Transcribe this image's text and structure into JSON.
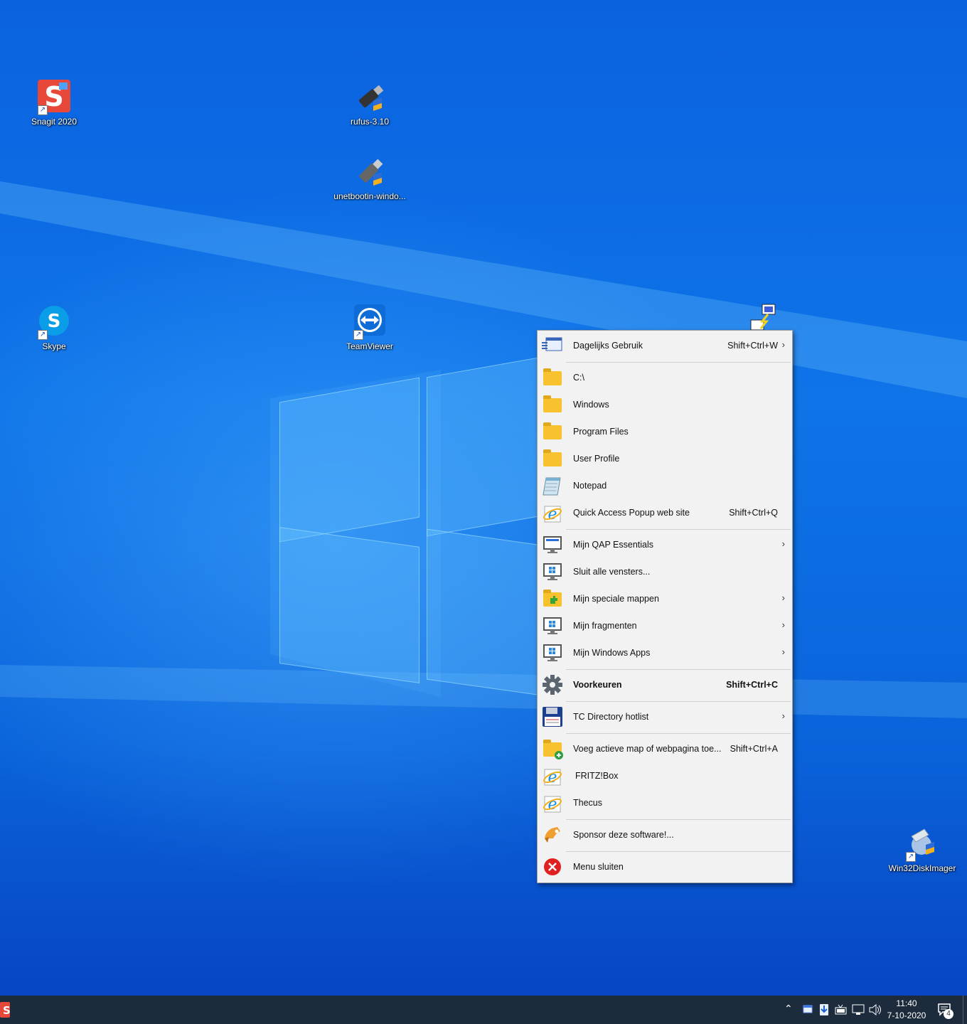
{
  "desktop": {
    "icons": [
      {
        "label": "Snagit 2020"
      },
      {
        "label": "rufus-3.10"
      },
      {
        "label": "unetbootin-windo..."
      },
      {
        "label": "Skype"
      },
      {
        "label": "TeamViewer"
      },
      {
        "label": "Win32DiskImager"
      }
    ]
  },
  "menu": {
    "items": [
      {
        "label": "Dagelijks Gebruik",
        "shortcut": "Shift+Ctrl+W",
        "submenu": true,
        "icon": "menu-icon"
      },
      {
        "label": "C:\\",
        "icon": "folder-icon"
      },
      {
        "label": "Windows",
        "icon": "folder-icon"
      },
      {
        "label": "Program Files",
        "icon": "folder-icon"
      },
      {
        "label": "User Profile",
        "icon": "folder-icon"
      },
      {
        "label": "Notepad",
        "icon": "notepad-icon"
      },
      {
        "label": "Quick Access Popup web site",
        "shortcut": "Shift+Ctrl+Q",
        "icon": "internet-explorer-icon"
      },
      {
        "label": "Mijn QAP Essentials",
        "submenu": true,
        "icon": "monitor-icon"
      },
      {
        "label": "Sluit alle vensters...",
        "icon": "monitor-windows-icon"
      },
      {
        "label": "Mijn speciale mappen",
        "submenu": true,
        "icon": "special-folder-icon"
      },
      {
        "label": "Mijn fragmenten",
        "submenu": true,
        "icon": "monitor-windows-icon"
      },
      {
        "label": "Mijn Windows Apps",
        "submenu": true,
        "icon": "monitor-windows-icon"
      },
      {
        "label": "Voorkeuren",
        "shortcut": "Shift+Ctrl+C",
        "icon": "gear-icon"
      },
      {
        "label": "TC Directory hotlist",
        "submenu": true,
        "icon": "floppy-disk-icon"
      },
      {
        "label": "Voeg actieve map of webpagina toe...",
        "shortcut": "Shift+Ctrl+A",
        "icon": "add-folder-icon"
      },
      {
        "label": "FRITZ!Box",
        "icon": "internet-explorer-icon"
      },
      {
        "label": "Thecus",
        "icon": "internet-explorer-icon"
      },
      {
        "label": "Sponsor deze software!...",
        "icon": "sponsor-icon"
      },
      {
        "label": "Menu sluiten",
        "icon": "close-icon"
      }
    ],
    "submenu_arrow": "›"
  },
  "taskbar": {
    "time": "11:40",
    "date": "7-10-2020",
    "notification_count": "4"
  },
  "colors": {
    "desktop_blue": "#0a5ad8",
    "taskbar": "#1d2c3c",
    "menu_bg": "#f2f2f2",
    "folder": "#f8c22e",
    "close_red": "#e02020"
  }
}
